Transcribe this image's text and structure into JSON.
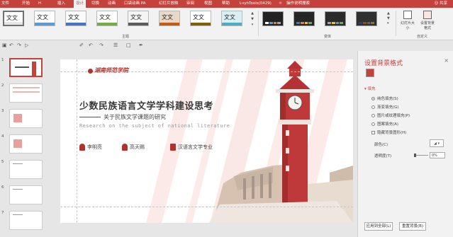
{
  "menubar": {
    "tabs": [
      "文件",
      "开始",
      "插入",
      "设计",
      "切换",
      "动画",
      "口袋动画 PA",
      "幻灯片放映",
      "审阅",
      "视图",
      "帮助",
      "LvyhTools(0429)",
      "操作说明搜索"
    ],
    "file_label": "文件",
    "share_label": "共享",
    "cursor_visible_text": "H"
  },
  "ribbon": {
    "themes": [
      {
        "text": "文文",
        "stripe": "#e6e6e6",
        "selected": true
      },
      {
        "text": "文文",
        "stripe": "#5b9bd5",
        "selected": false
      },
      {
        "text": "文文",
        "stripe": "#4472c4",
        "selected": false
      },
      {
        "text": "文文",
        "stripe": "#70ad47",
        "selected": false
      },
      {
        "text": "文文",
        "stripe": "#5b5b5b",
        "selected": false
      },
      {
        "text": "文文",
        "stripe": "#c55a11",
        "selected": false
      },
      {
        "text": "文文",
        "stripe": "#7f6000",
        "selected": false
      },
      {
        "text": "文文",
        "stripe": "#4bacc6",
        "selected": false
      }
    ],
    "group_theme": "主题",
    "group_variant": "变体",
    "group_custom": "自定义",
    "slide_size_label": "幻灯片大小",
    "format_bg_label": "设置背景格式",
    "variants": [
      {
        "bg": "#222222",
        "dots": [
          "#ffffff",
          "#5b9bd5",
          "#ed7d31",
          "#a5a5a5"
        ]
      },
      {
        "bg": "#262626",
        "dots": [
          "#4472c4",
          "#ed7d31",
          "#ffc000",
          "#70ad47"
        ]
      },
      {
        "bg": "#2a2a2a",
        "dots": [
          "#a5a5a5",
          "#ffc000",
          "#5b9bd5",
          "#70ad47"
        ]
      },
      {
        "bg": "#303030",
        "dots": [
          "#264478",
          "#9e480e",
          "#636363",
          "#997300"
        ]
      }
    ]
  },
  "thumbnails": [
    {
      "num": "1",
      "selected": true
    },
    {
      "num": "2",
      "selected": false
    },
    {
      "num": "3",
      "selected": false
    },
    {
      "num": "4",
      "selected": false
    },
    {
      "num": "5",
      "selected": false
    },
    {
      "num": "6",
      "selected": false
    },
    {
      "num": "7",
      "selected": false
    }
  ],
  "slide": {
    "logo_text": "湖南师范学院",
    "title": "少数民族语言文学学科建设思考",
    "subtitle": "关于民族文学课题的研究",
    "english_title": "Research on the subject of national literature",
    "person1": "李明亮",
    "person2": "高天赐",
    "major": "汉语言文学专业",
    "accent_color": "#b2322c"
  },
  "pane": {
    "title": "设置背景格式",
    "close_glyph": "×",
    "fill_section": "填充",
    "options": [
      {
        "label": "纯色填充(S)",
        "checked": true
      },
      {
        "label": "渐变填充(G)",
        "checked": false
      },
      {
        "label": "图片或纹理填充(P)",
        "checked": false
      },
      {
        "label": "图案填充(A)",
        "checked": false
      }
    ],
    "hide_bg_label": "隐藏背景图形(H)",
    "color_label": "颜色(C)",
    "transparency_label": "透明度(T)",
    "transparency_value": "0%",
    "apply_all_label": "应用到全部(L)",
    "reset_label": "重置背景(B)"
  }
}
